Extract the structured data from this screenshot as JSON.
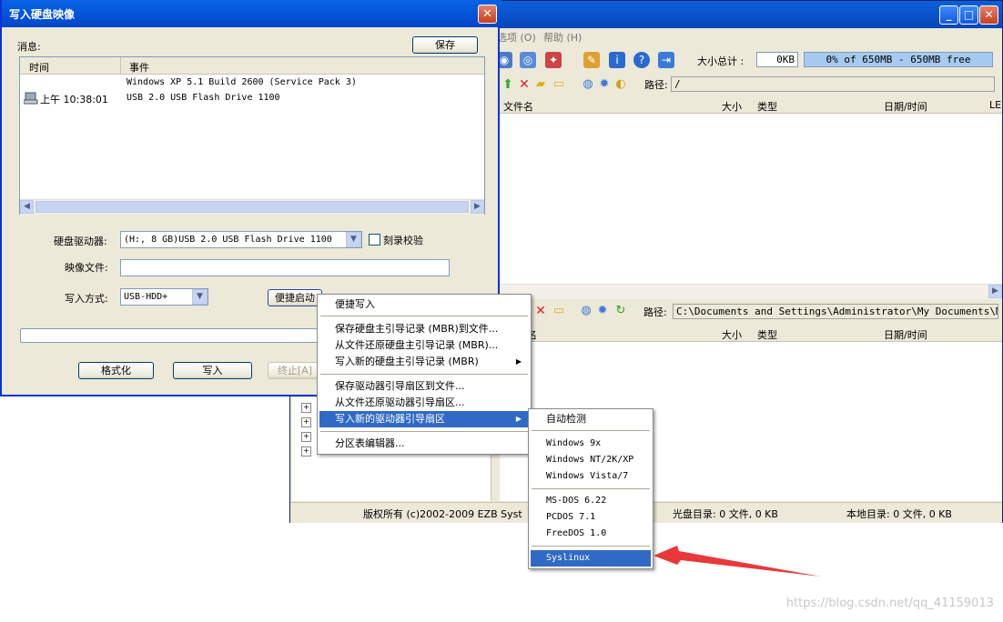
{
  "main_window": {
    "menu": [
      "选项 (O)",
      "帮助 (H)"
    ],
    "size_total_label": "大小总计 :",
    "size_total_value": "0KB",
    "capacity_bar": "0% of 650MB - 650MB free",
    "path_label": "路径:",
    "upper_path": "/",
    "lower_path": "C:\\Documents and Settings\\Administrator\\My Documents\\My ISO",
    "upper_columns": [
      "文件名",
      "大小",
      "类型",
      "日期/时间",
      "LE"
    ],
    "lower_columns": [
      "名",
      "大小",
      "类型",
      "日期/时间"
    ],
    "status": {
      "copyright": "版权所有  (c)2002-2009 EZB Syst",
      "disc_dir": "光盘目录: 0 文件, 0 KB",
      "local_dir": "本地目录: 0 文件, 0 KB"
    }
  },
  "dialog": {
    "title": "写入硬盘映像",
    "close": "✕",
    "messages_label": "消息:",
    "save_button": "保存",
    "columns": [
      "时间",
      "事件"
    ],
    "log": [
      {
        "time": "",
        "event": "Windows XP 5.1 Build 2600  (Service Pack 3)"
      },
      {
        "time": "上午 10:38:01",
        "event": "USB 2.0 USB Flash Drive 1100"
      }
    ],
    "disk_drive_label": "硬盘驱动器:",
    "disk_drive_value": "(H:, 8 GB)USB 2.0 USB Flash Drive 1100",
    "verify_label": "刻录校验",
    "image_file_label": "映像文件:",
    "image_file_value": "",
    "write_method_label": "写入方式:",
    "write_method_value": "USB-HDD+",
    "boot_button": "便捷启动",
    "format_button": "格式化",
    "write_button": "写入",
    "stop_button": "终止[A]"
  },
  "boot_menu": {
    "items": [
      "便捷写入",
      "保存硬盘主引导记录 (MBR)到文件...",
      "从文件还原硬盘主引导记录 (MBR)...",
      "写入新的硬盘主引导记录 (MBR)",
      "保存驱动器引导扇区到文件...",
      "从文件还原驱动器引导扇区...",
      "写入新的驱动器引导扇区",
      "分区表编辑器..."
    ]
  },
  "sector_menu": {
    "items": [
      "自动检测",
      "Windows 9x",
      "Windows NT/2K/XP",
      "Windows Vista/7",
      "MS-DOS 6.22",
      "PCDOS 7.1",
      "FreeDOS 1.0",
      "Syslinux"
    ]
  },
  "watermark": "https://blog.csdn.net/qq_41159013",
  "colors": {
    "selection": "#316ac5",
    "arrow": "#e8383a",
    "titlebar": "#0558dc"
  }
}
